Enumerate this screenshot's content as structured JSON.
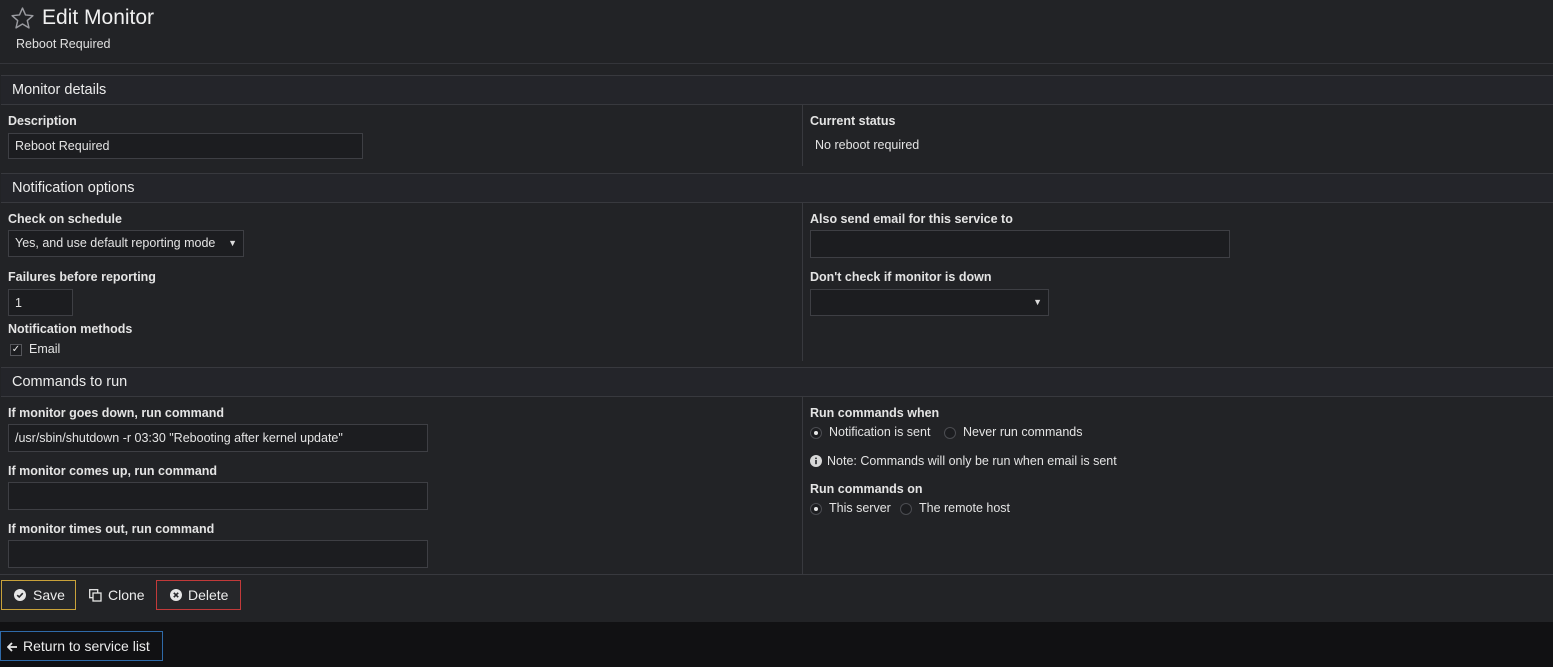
{
  "header": {
    "title": "Edit Monitor",
    "subtitle": "Reboot Required",
    "star_icon": "star-outline-icon"
  },
  "sections": {
    "details": "Monitor details",
    "notifications": "Notification options",
    "commands": "Commands to run"
  },
  "details": {
    "description_label": "Description",
    "description_value": "Reboot Required",
    "status_label": "Current status",
    "status_value": "No reboot required"
  },
  "notifications": {
    "schedule_label": "Check on schedule",
    "schedule_value": "Yes, and use default reporting mode",
    "failures_label": "Failures before reporting",
    "failures_value": "1",
    "methods_label": "Notification methods",
    "email_label": "Email",
    "email_checked": true,
    "also_email_label": "Also send email for this service to",
    "also_email_value": "",
    "dont_check_label": "Don't check if monitor is down",
    "dont_check_value": ""
  },
  "commands": {
    "down_label": "If monitor goes down, run command",
    "down_value": "/usr/sbin/shutdown -r 03:30 \"Rebooting after kernel update\"",
    "up_label": "If monitor comes up, run command",
    "up_value": "",
    "timeout_label": "If monitor times out, run command",
    "timeout_value": "",
    "run_when_label": "Run commands when",
    "run_when_options": [
      "Notification is sent",
      "Never run commands"
    ],
    "run_when_selected": "Notification is sent",
    "note": "Note: Commands will only be run when email is sent",
    "run_on_label": "Run commands on",
    "run_on_options": [
      "This server",
      "The remote host"
    ],
    "run_on_selected": "This server"
  },
  "buttons": {
    "save": "Save",
    "clone": "Clone",
    "delete": "Delete",
    "return": "Return to service list"
  },
  "colors": {
    "save_border": "#c9a23a",
    "delete_border": "#c23a3a",
    "return_border": "#2f6aa8",
    "panel_bg": "#222326"
  }
}
